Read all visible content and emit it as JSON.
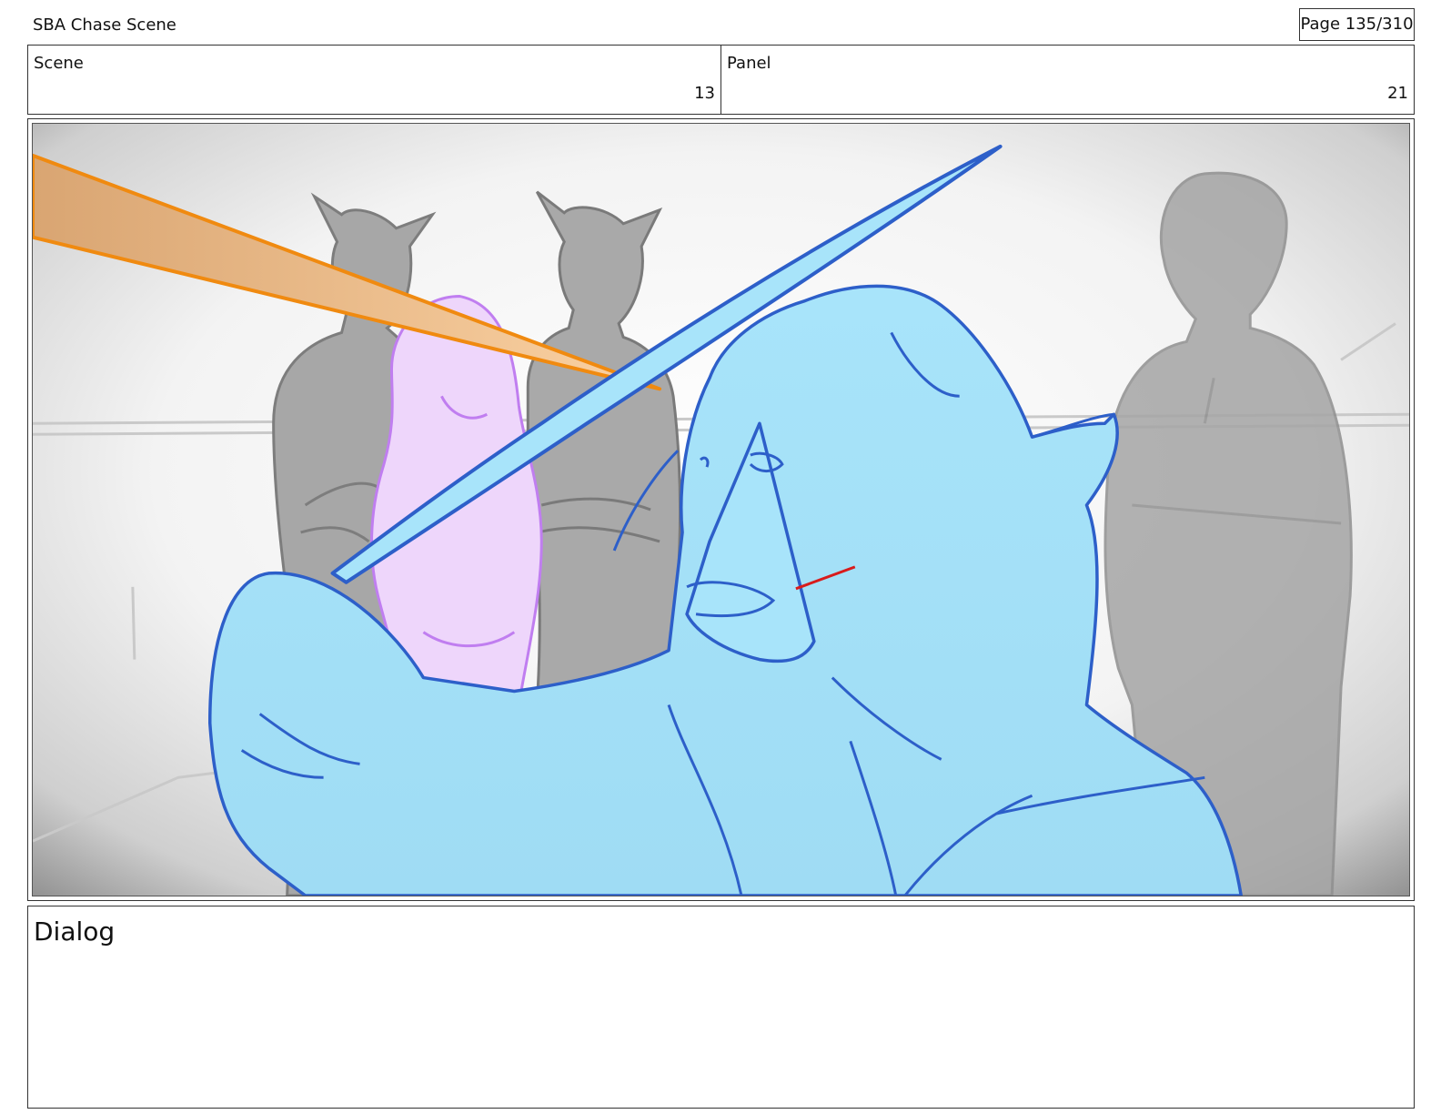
{
  "document": {
    "title": "SBA Chase Scene",
    "page_indicator": "Page 135/310"
  },
  "info": {
    "scene_label": "Scene",
    "scene_value": "13",
    "panel_label": "Panel",
    "panel_value": "21"
  },
  "dialog": {
    "label": "Dialog"
  },
  "colors": {
    "hero_fill": "#a8e4fa",
    "hero_line": "#2d5fc9",
    "background_figures": "#9b9b9b",
    "girl_fill": "#eed6fb",
    "girl_line": "#c07ef0",
    "beam_fill": "#fbd2a3",
    "beam_line": "#f08a10",
    "wound": "#d81b1b"
  }
}
